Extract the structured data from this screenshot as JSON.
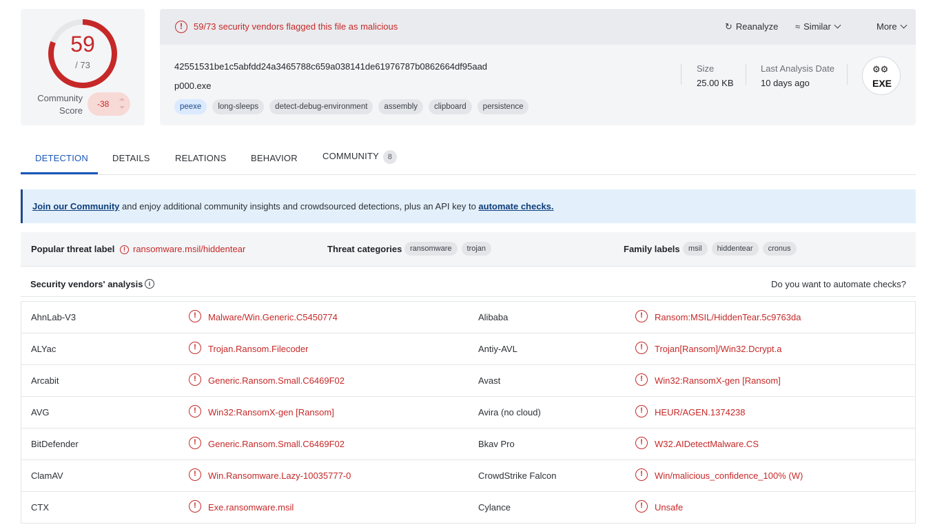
{
  "score": {
    "detections": "59",
    "total": "/ 73",
    "detection_fraction": 0.808,
    "community_label_line1": "Community",
    "community_label_line2": "Score",
    "community_score": "-38"
  },
  "alert": {
    "text": "59/73 security vendors flagged this file as malicious",
    "reanalyze": "Reanalyze",
    "similar": "Similar",
    "more": "More"
  },
  "file": {
    "hash": "42551531be1c5abfdd24a3465788c659a038141de61976787b0862664df95aad",
    "name": "p000.exe",
    "tags": [
      "peexe",
      "long-sleeps",
      "detect-debug-environment",
      "assembly",
      "clipboard",
      "persistence"
    ],
    "size_label": "Size",
    "size_value": "25.00 KB",
    "date_label": "Last Analysis Date",
    "date_value": "10 days ago",
    "type_badge": "EXE"
  },
  "tabs": [
    {
      "label": "DETECTION"
    },
    {
      "label": "DETAILS"
    },
    {
      "label": "RELATIONS"
    },
    {
      "label": "BEHAVIOR"
    },
    {
      "label": "COMMUNITY",
      "count": "8"
    }
  ],
  "banner": {
    "link1": "Join our Community",
    "middle": " and enjoy additional community insights and crowdsourced detections, plus an API key to ",
    "link2": "automate checks."
  },
  "threat": {
    "popular_label": "Popular threat label",
    "popular_value": "ransomware.msil/hiddentear",
    "categories_label": "Threat categories",
    "categories": [
      "ransomware",
      "trojan"
    ],
    "family_label": "Family labels",
    "families": [
      "msil",
      "hiddentear",
      "cronus"
    ]
  },
  "vendors": {
    "title": "Security vendors' analysis",
    "automate": "Do you want to automate checks?",
    "rows": [
      {
        "left_name": "AhnLab-V3",
        "left_result": "Malware/Win.Generic.C5450774",
        "right_name": "Alibaba",
        "right_result": "Ransom:MSIL/HiddenTear.5c9763da"
      },
      {
        "left_name": "ALYac",
        "left_result": "Trojan.Ransom.Filecoder",
        "right_name": "Antiy-AVL",
        "right_result": "Trojan[Ransom]/Win32.Dcrypt.a"
      },
      {
        "left_name": "Arcabit",
        "left_result": "Generic.Ransom.Small.C6469F02",
        "right_name": "Avast",
        "right_result": "Win32:RansomX-gen [Ransom]"
      },
      {
        "left_name": "AVG",
        "left_result": "Win32:RansomX-gen [Ransom]",
        "right_name": "Avira (no cloud)",
        "right_result": "HEUR/AGEN.1374238"
      },
      {
        "left_name": "BitDefender",
        "left_result": "Generic.Ransom.Small.C6469F02",
        "right_name": "Bkav Pro",
        "right_result": "W32.AIDetectMalware.CS"
      },
      {
        "left_name": "ClamAV",
        "left_result": "Win.Ransomware.Lazy-10035777-0",
        "right_name": "CrowdStrike Falcon",
        "right_result": "Win/malicious_confidence_100% (W)"
      },
      {
        "left_name": "CTX",
        "left_result": "Exe.ransomware.msil",
        "right_name": "Cylance",
        "right_result": "Unsafe"
      }
    ]
  }
}
